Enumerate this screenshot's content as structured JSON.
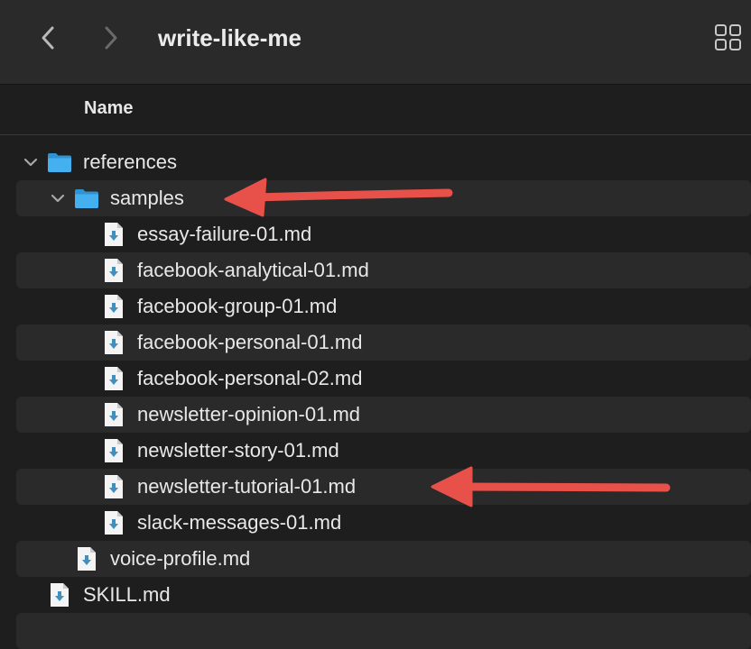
{
  "window": {
    "title": "write-like-me"
  },
  "columns": {
    "name_label": "Name"
  },
  "icons": {
    "back": "chevron-left-icon",
    "forward": "chevron-right-icon",
    "view": "grid-view-icon",
    "folder": "folder-icon",
    "file": "markdown-file-icon",
    "expanded": "chevron-down-icon"
  },
  "colors": {
    "background": "#1e1e1e",
    "stripe": "#2a2a2a",
    "folder": "#38a5e5",
    "file_arrow": "#3f8fbf",
    "annotation_arrow": "#e8514a"
  },
  "tree": [
    {
      "label": "references",
      "kind": "folder",
      "expanded": true
    },
    {
      "label": "samples",
      "kind": "folder",
      "expanded": true
    },
    {
      "label": "essay-failure-01.md",
      "kind": "file"
    },
    {
      "label": "facebook-analytical-01.md",
      "kind": "file"
    },
    {
      "label": "facebook-group-01.md",
      "kind": "file"
    },
    {
      "label": "facebook-personal-01.md",
      "kind": "file"
    },
    {
      "label": "facebook-personal-02.md",
      "kind": "file"
    },
    {
      "label": "newsletter-opinion-01.md",
      "kind": "file"
    },
    {
      "label": "newsletter-story-01.md",
      "kind": "file"
    },
    {
      "label": "newsletter-tutorial-01.md",
      "kind": "file"
    },
    {
      "label": "slack-messages-01.md",
      "kind": "file"
    },
    {
      "label": "voice-profile.md",
      "kind": "file"
    },
    {
      "label": "SKILL.md",
      "kind": "file"
    }
  ],
  "annotations": [
    {
      "points_to": "samples"
    },
    {
      "points_to": "newsletter-tutorial-01.md"
    }
  ]
}
